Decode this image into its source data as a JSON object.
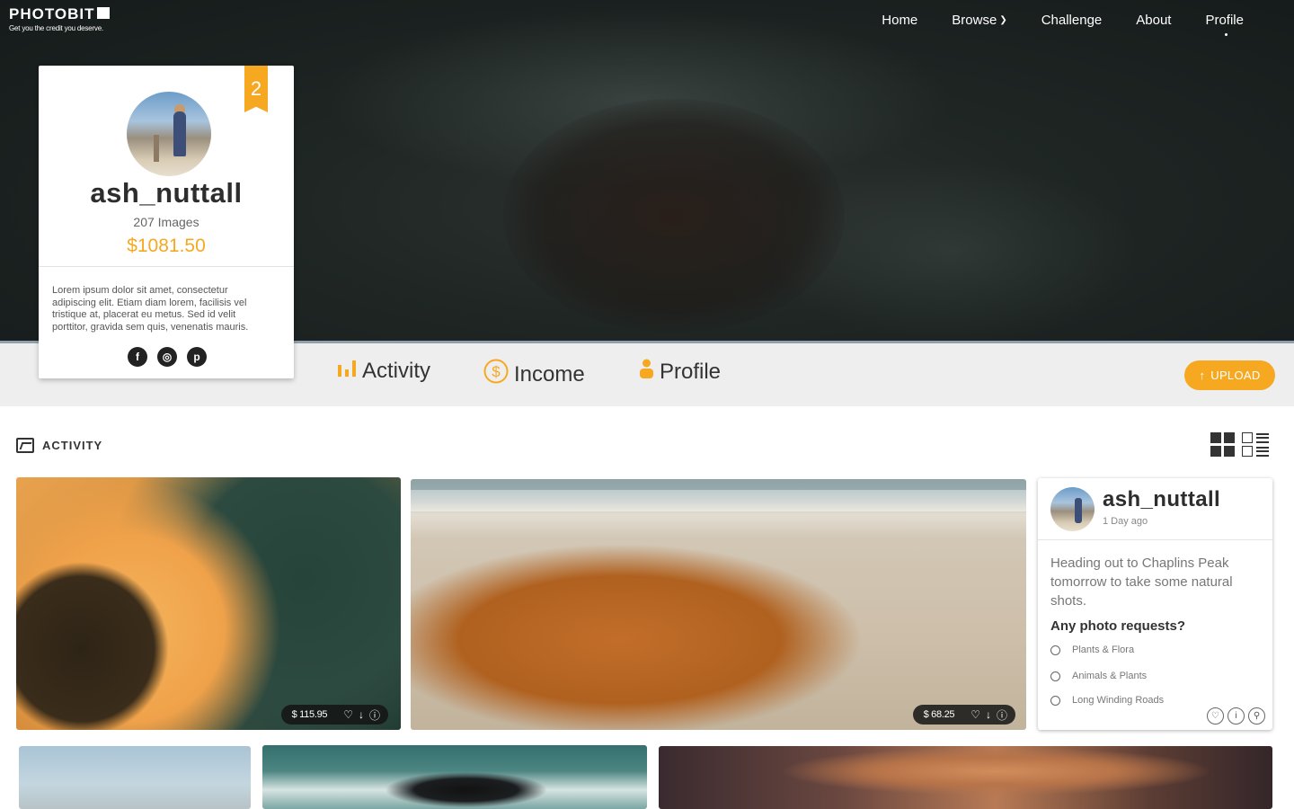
{
  "brand": {
    "name": "PHOTOBIT",
    "tagline": "Get you the credit you deserve."
  },
  "nav": {
    "items": [
      {
        "label": "Home"
      },
      {
        "label": "Browse",
        "has_dropdown": true
      },
      {
        "label": "Challenge"
      },
      {
        "label": "About"
      },
      {
        "label": "Profile",
        "active": true
      }
    ]
  },
  "profile": {
    "rank": "2",
    "username": "ash_nuttall",
    "images_count": "207 Images",
    "earnings": "$1081.50",
    "bio": "Lorem ipsum dolor sit amet, consectetur adipiscing elit. Etiam diam lorem, facilisis vel tristique at, placerat eu metus. Sed id velit porttitor, gravida sem quis, venenatis mauris.",
    "socials": [
      {
        "icon": "facebook-icon",
        "glyph": "f"
      },
      {
        "icon": "instagram-icon",
        "glyph": "◎"
      },
      {
        "icon": "pinterest-icon",
        "glyph": "p"
      }
    ]
  },
  "tabs": [
    {
      "label": "Activity",
      "icon": "bar-chart-icon"
    },
    {
      "label": "Income",
      "icon": "dollar-circle-icon"
    },
    {
      "label": "Profile",
      "icon": "person-icon"
    }
  ],
  "upload": {
    "label": "UPLOAD"
  },
  "activity": {
    "heading": "ACTIVITY"
  },
  "photos": [
    {
      "price": "$ 115.95"
    },
    {
      "price": "$ 68.25"
    }
  ],
  "post": {
    "username": "ash_nuttall",
    "time": "1 Day ago",
    "text": "Heading out to Chaplins Peak tomorrow to take some natural shots.",
    "question": "Any photo requests?",
    "options": [
      "Plants & Flora",
      "Animals & Plants",
      "Long Winding Roads"
    ]
  },
  "colors": {
    "accent": "#f6a821",
    "tabbar_bg": "#efeeee",
    "text_dark": "#2d2d2d"
  }
}
